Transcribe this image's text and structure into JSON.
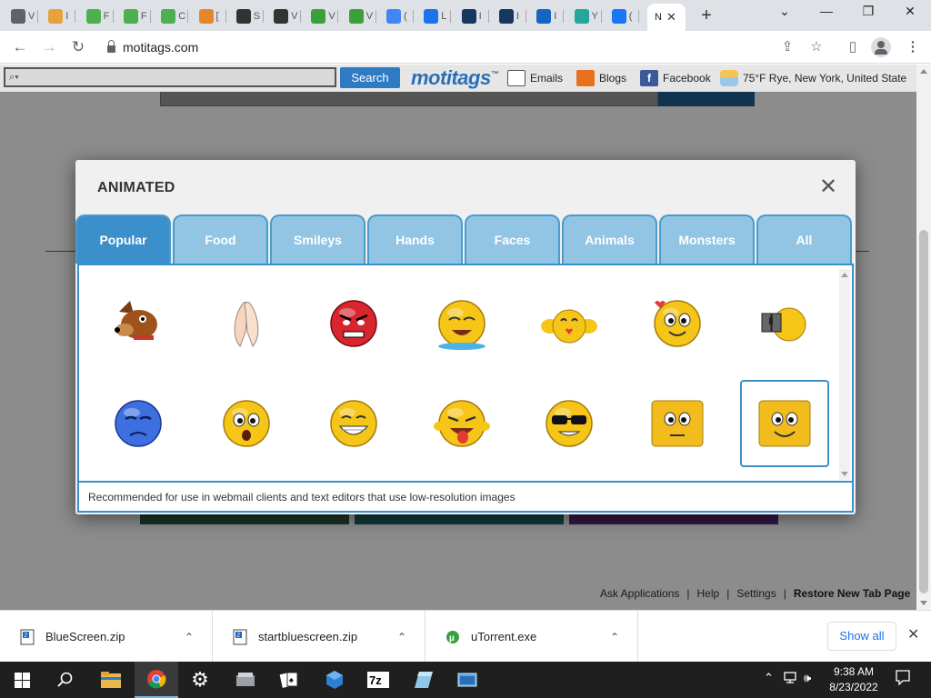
{
  "browser": {
    "tabs": [
      {
        "label": "V",
        "icon": "chrome-icon",
        "color": "#5f6368"
      },
      {
        "label": "I",
        "icon": "rainbow-icon",
        "color": "#e6a23c"
      },
      {
        "label": "F",
        "icon": "download-icon",
        "color": "#4caf50"
      },
      {
        "label": "F",
        "icon": "download-icon",
        "color": "#4caf50"
      },
      {
        "label": "C",
        "icon": "download-icon",
        "color": "#4caf50"
      },
      {
        "label": "[",
        "icon": "orange-circle-icon",
        "color": "#e6862c"
      },
      {
        "label": "S",
        "icon": "newspaper-icon",
        "color": "#333333"
      },
      {
        "label": "V",
        "icon": "newspaper-icon",
        "color": "#333333"
      },
      {
        "label": "V",
        "icon": "wordpress-icon",
        "color": "#3aa13a"
      },
      {
        "label": "V",
        "icon": "wordpress-icon",
        "color": "#3aa13a"
      },
      {
        "label": "(",
        "icon": "google-icon",
        "color": "#4285f4"
      },
      {
        "label": "L",
        "icon": "star-icon",
        "color": "#1a73e8"
      },
      {
        "label": "I",
        "icon": "pe-icon",
        "color": "#17375e"
      },
      {
        "label": "I",
        "icon": "quora-icon",
        "color": "#17375e"
      },
      {
        "label": "I",
        "icon": "s-icon",
        "color": "#1565c0"
      },
      {
        "label": "Y",
        "icon": "r-icon",
        "color": "#26a69a"
      },
      {
        "label": "(",
        "icon": "facebook-icon",
        "color": "#1877f2"
      }
    ],
    "active_tab": {
      "label": "N",
      "icon": "motitags-icon"
    },
    "close_glyph": "✕",
    "new_tab": "+",
    "window_controls": {
      "tablist": "⌄",
      "minimize": "—",
      "restore": "❐",
      "close": "✕"
    },
    "url": "motitags.com",
    "nav": {
      "back": "←",
      "forward": "→",
      "reload": "↻"
    },
    "toolbar_icons": {
      "share": "⇪",
      "bookmark": "☆",
      "sidepanel": "▯"
    }
  },
  "ask_toolbar": {
    "search_placeholder": "⌕▾",
    "search_button": "Search",
    "logo": "motitags",
    "logo_tm": "™",
    "emails": "Emails",
    "blogs": "Blogs",
    "facebook": "Facebook",
    "weather": "75°F Rye, New York, United State"
  },
  "background_footer": {
    "links": [
      "Ask Applications",
      "Help",
      "Settings"
    ],
    "separator": "|",
    "restore": "Restore New Tab Page"
  },
  "modal": {
    "title": "ANIMATED",
    "close": "✕",
    "tabs": [
      "Popular",
      "Food",
      "Smileys",
      "Hands",
      "Faces",
      "Animals",
      "Monsters",
      "All"
    ],
    "active_tab": "Popular",
    "emojis": [
      {
        "name": "dog-face-emoji"
      },
      {
        "name": "praying-hands-emoji"
      },
      {
        "name": "angry-red-face-emoji"
      },
      {
        "name": "crying-laughing-emoji"
      },
      {
        "name": "heart-smiley-emoji"
      },
      {
        "name": "in-love-face-emoji"
      },
      {
        "name": "binoculars-face-emoji"
      },
      {
        "name": "sad-blue-face-emoji"
      },
      {
        "name": "shocked-face-emoji"
      },
      {
        "name": "grinning-face-emoji"
      },
      {
        "name": "tongue-out-face-emoji"
      },
      {
        "name": "sunglasses-face-emoji"
      },
      {
        "name": "square-bored-face-emoji"
      },
      {
        "name": "square-smile-face-emoji"
      }
    ],
    "selected_index": 13,
    "footer_text": "Recommended for use in webmail clients and text editors that use low-resolution images"
  },
  "downloads": {
    "items": [
      {
        "name": "BlueScreen.zip",
        "icon": "zip-file-icon"
      },
      {
        "name": "startbluescreen.zip",
        "icon": "zip-file-icon"
      },
      {
        "name": "uTorrent.exe",
        "icon": "utorrent-icon"
      }
    ],
    "caret": "⌃",
    "show_all": "Show all",
    "close": "✕"
  },
  "taskbar": {
    "time": "9:38 AM",
    "date": "8/23/2022",
    "tray": {
      "chevron": "⌃",
      "volume": "🕪"
    }
  },
  "colors": {
    "tab_active": "#3b8fca",
    "tab_inactive": "#92c5e3",
    "ask_button": "#2e7bc4"
  }
}
